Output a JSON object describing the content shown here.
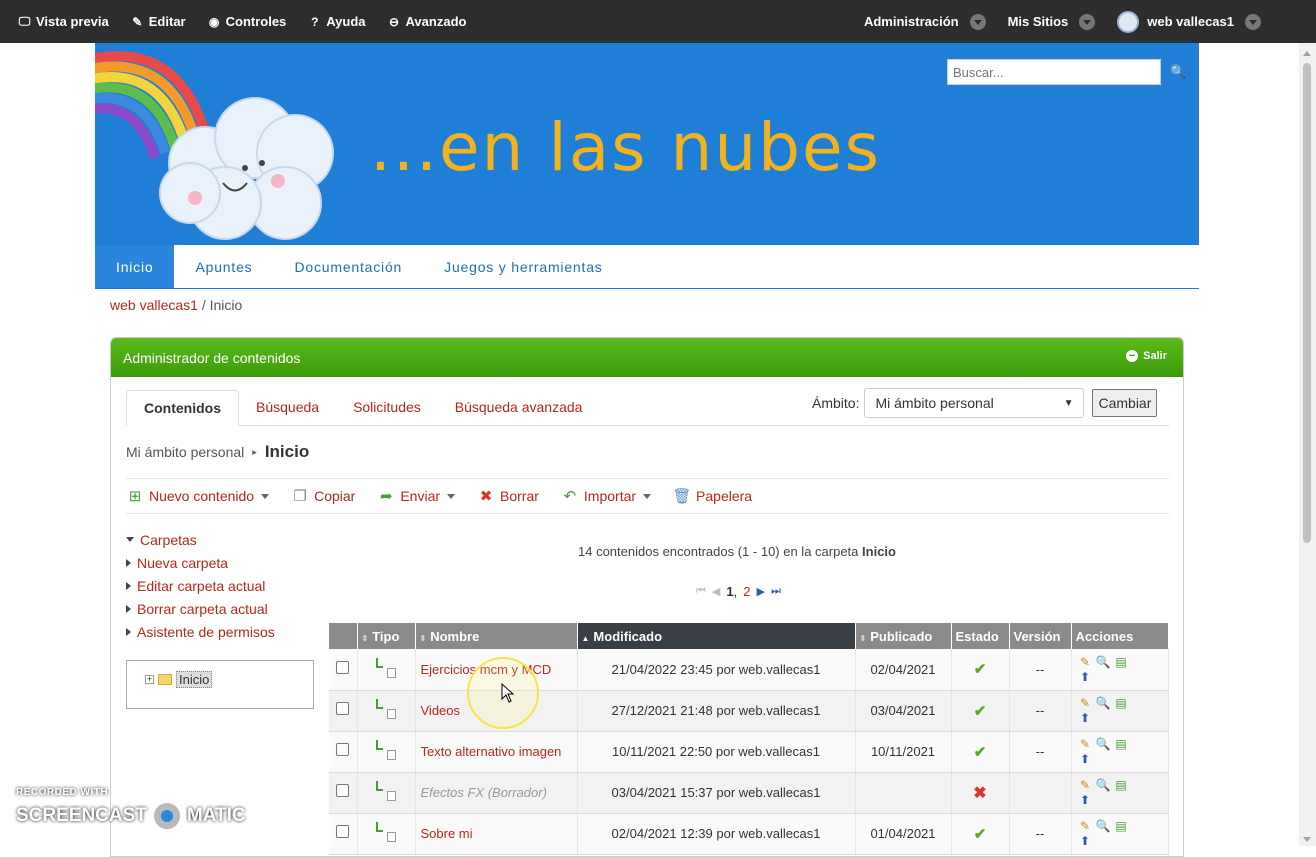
{
  "topbar": {
    "left": [
      {
        "icon": "monitor-icon",
        "glyph": "🖵",
        "label": "Vista previa"
      },
      {
        "icon": "edit-icon",
        "glyph": "✎",
        "label": "Editar"
      },
      {
        "icon": "eye-icon",
        "glyph": "◉",
        "label": "Controles"
      },
      {
        "icon": "help-icon",
        "glyph": "?",
        "label": "Ayuda"
      },
      {
        "icon": "minus-circle-icon",
        "glyph": "⊖",
        "label": "Avanzado"
      }
    ],
    "admin": "Administración",
    "sites": "Mis Sitios",
    "user": "web vallecas1"
  },
  "banner": {
    "title": "...en las nubes",
    "search_placeholder": "Buscar...",
    "bg_color": "#1f7fd6",
    "title_color": "#f2b11e"
  },
  "nav": {
    "tabs": [
      "Inicio",
      "Apuntes",
      "Documentación",
      "Juegos y herramientas"
    ],
    "active": 0
  },
  "breadcrumb": {
    "link": "web vallecas1",
    "sep": "/",
    "current": "Inicio"
  },
  "portlet": {
    "title": "Administrador de contenidos",
    "exit": "Salir",
    "tabs": [
      "Contenidos",
      "Búsqueda",
      "Solicitudes",
      "Búsqueda avanzada"
    ],
    "scope_label": "Ámbito:",
    "scope_value": "Mi ámbito personal",
    "change_button": "Cambiar",
    "crumb_parent": "Mi ámbito personal",
    "crumb_current": "Inicio",
    "toolbar": {
      "new": "Nuevo contenido",
      "copy": "Copiar",
      "send": "Enviar",
      "delete": "Borrar",
      "import": "Importar",
      "trash": "Papelera"
    },
    "tree": {
      "header": "Carpetas",
      "items": [
        "Nueva carpeta",
        "Editar carpeta actual",
        "Borrar carpeta actual",
        "Asistente de permisos"
      ],
      "root": "Inicio"
    },
    "results": {
      "prefix": "14 contenidos encontrados (1 - 10) en la carpeta",
      "folder": "Inicio"
    },
    "pager": {
      "current": "1",
      "sep": ",",
      "next": "2"
    },
    "table": {
      "headers": [
        "Tipo",
        "Nombre",
        "Modificado",
        "Publicado",
        "Estado",
        "Versión",
        "Acciones"
      ],
      "rows": [
        {
          "name": "Ejercicios mcm y MCD",
          "modified": "21/04/2022 23:45 por web.vallecas1",
          "published": "02/04/2021",
          "status": "ok",
          "version": "--",
          "draft": false
        },
        {
          "name": "Videos",
          "modified": "27/12/2021 21:48 por web.vallecas1",
          "published": "03/04/2021",
          "status": "ok",
          "version": "--",
          "draft": false
        },
        {
          "name": "Texto alternativo imagen",
          "modified": "10/11/2021 22:50 por web.vallecas1",
          "published": "10/11/2021",
          "status": "ok",
          "version": "--",
          "draft": false
        },
        {
          "name": "Efectos FX (Borrador)",
          "modified": "03/04/2021 15:37 por web.vallecas1",
          "published": "",
          "status": "x",
          "version": "",
          "draft": true
        },
        {
          "name": "Sobre mi",
          "modified": "02/04/2021 12:39 por web.vallecas1",
          "published": "01/04/2021",
          "status": "ok",
          "version": "--",
          "draft": false
        }
      ]
    }
  },
  "watermark": {
    "line1": "RECORDED WITH",
    "left": "SCREENCAST",
    "right": "MATIC"
  }
}
